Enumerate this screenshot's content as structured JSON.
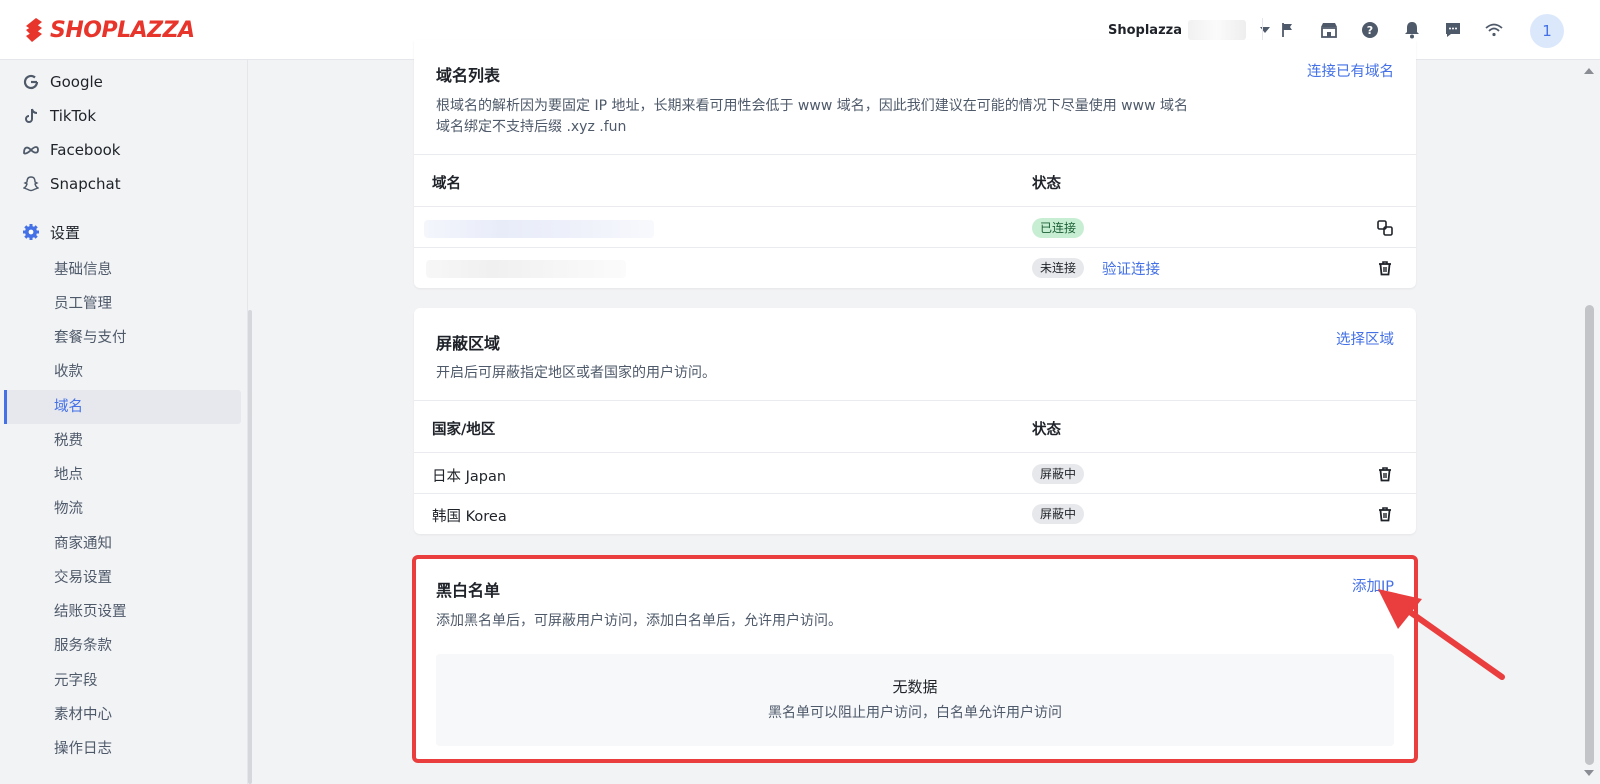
{
  "brand": {
    "name": "SHOPLAZZA",
    "color": "#e8352b"
  },
  "topbar": {
    "store_name": "Shoplazza",
    "icons": [
      "flag-icon",
      "store-icon",
      "help-icon",
      "bell-icon",
      "message-icon",
      "wifi-icon"
    ],
    "avatar_label": "1"
  },
  "sidebar": {
    "channels": [
      {
        "label": "Google",
        "icon": "google-icon"
      },
      {
        "label": "TikTok",
        "icon": "tiktok-icon"
      },
      {
        "label": "Facebook",
        "icon": "meta-icon"
      },
      {
        "label": "Snapchat",
        "icon": "snapchat-icon"
      }
    ],
    "settings_label": "设置",
    "settings_items": [
      "基础信息",
      "员工管理",
      "套餐与支付",
      "收款",
      "域名",
      "税费",
      "地点",
      "物流",
      "商家通知",
      "交易设置",
      "结账页设置",
      "服务条款",
      "元字段",
      "素材中心",
      "操作日志"
    ],
    "active_item": "域名"
  },
  "domain_card": {
    "title": "域名列表",
    "action": "连接已有域名",
    "desc_line1": "根域名的解析因为要固定 IP 地址，长期来看可用性会低于 www 域名，因此我们建议在可能的情况下尽量使用 www 域名",
    "desc_line2": "域名绑定不支持后缀 .xyz .fun",
    "col_domain": "域名",
    "col_status": "状态",
    "rows": [
      {
        "status": "已连接",
        "icon": "copy-link-icon"
      },
      {
        "status": "未连接",
        "link": "验证连接",
        "icon": "trash-icon"
      }
    ]
  },
  "block_card": {
    "title": "屏蔽区域",
    "action": "选择区域",
    "desc": "开启后可屏蔽指定地区或者国家的用户访问。",
    "col_region": "国家/地区",
    "col_status": "状态",
    "rows": [
      {
        "region": "日本 Japan",
        "status": "屏蔽中"
      },
      {
        "region": "韩国 Korea",
        "status": "屏蔽中"
      }
    ]
  },
  "ip_card": {
    "title": "黑白名单",
    "action": "添加IP",
    "desc": "添加黑名单后，可屏蔽用户访问，添加白名单后，允许用户访问。",
    "empty_title": "无数据",
    "empty_sub": "黑名单可以阻止用户访问，白名单允许用户访问"
  },
  "colors": {
    "accent": "#4471e6",
    "highlight": "#ea3e3e"
  }
}
